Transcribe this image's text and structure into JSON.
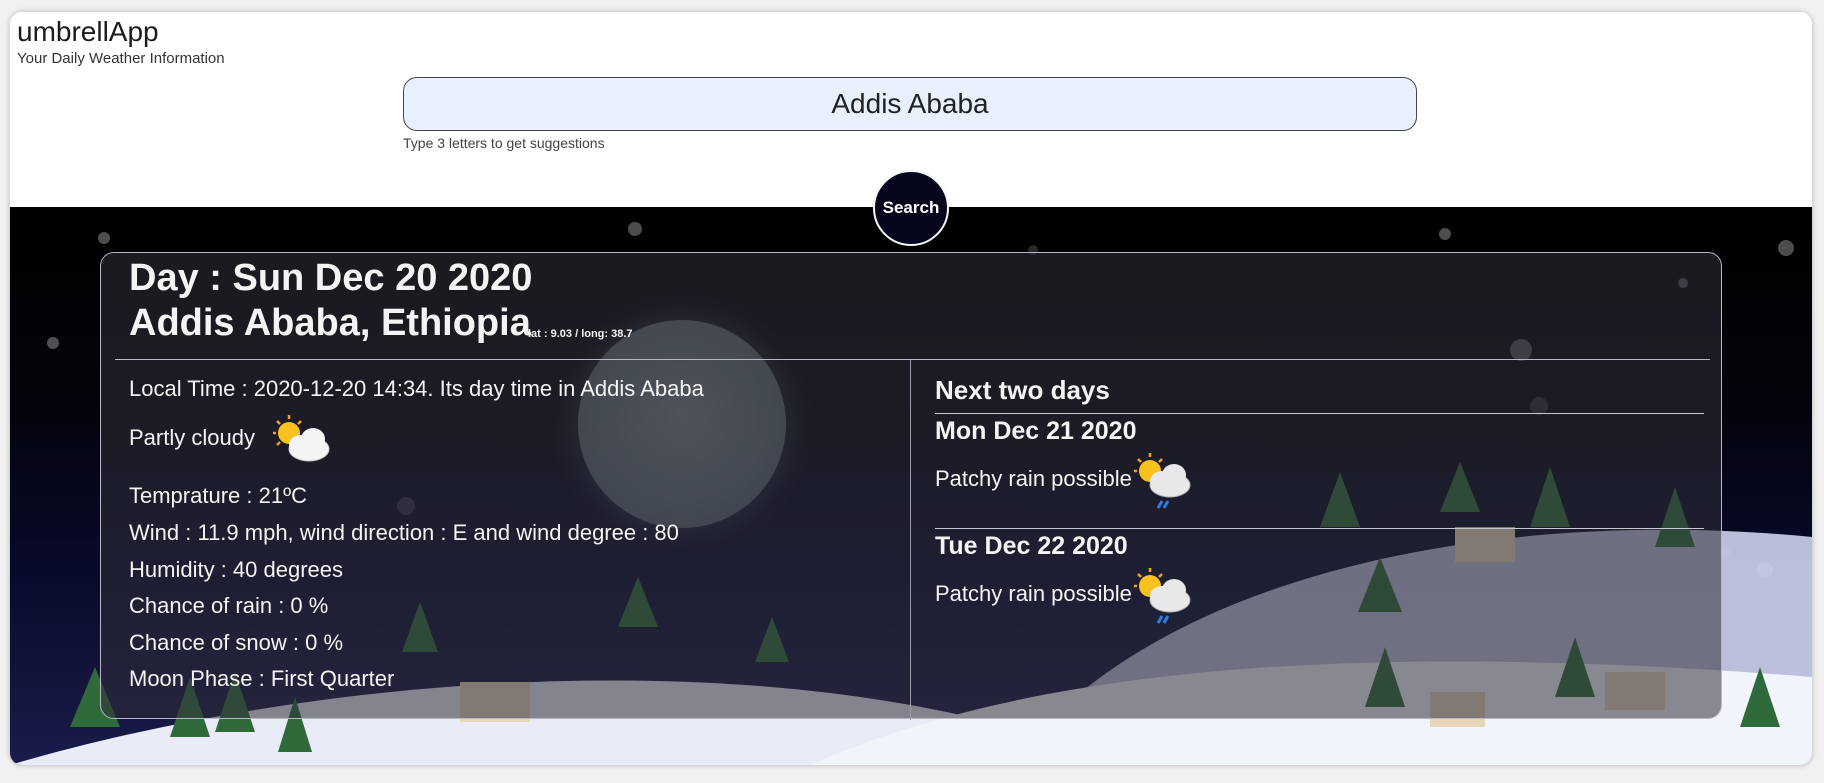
{
  "app": {
    "title": "umbrellApp",
    "tagline": "Your Daily Weather Information"
  },
  "search": {
    "value": "Addis Ababa",
    "hint": "Type 3 letters to get suggestions",
    "button_label": "Search"
  },
  "current": {
    "day_title": "Day : Sun Dec 20 2020",
    "location_title": "Addis Ababa, Ethiopia",
    "coords": "lat : 9.03 / long: 38.7",
    "local_time": "Local Time : 2020-12-20 14:34. Its day time in Addis Ababa",
    "condition": "Partly cloudy",
    "condition_icon": "partly-cloudy-icon",
    "temperature": "Temprature : 21ºC",
    "wind": "Wind : 11.9 mph, wind direction : E and wind degree : 80",
    "humidity": "Humidity : 40 degrees",
    "chance_of_rain": "Chance of rain : 0 %",
    "chance_of_snow": "Chance of snow : 0 %",
    "moon_phase": "Moon Phase : First Quarter"
  },
  "forecast": {
    "title": "Next two days",
    "days": [
      {
        "date": "Mon Dec 21 2020",
        "condition": "Patchy rain possible",
        "icon": "patchy-rain-icon"
      },
      {
        "date": "Tue Dec 22 2020",
        "condition": "Patchy rain possible",
        "icon": "patchy-rain-icon"
      }
    ]
  },
  "colors": {
    "card_bg": "#303038",
    "button_bg": "#06061c",
    "input_bg": "#e8f0fe",
    "text_light": "#f4f4f4"
  }
}
